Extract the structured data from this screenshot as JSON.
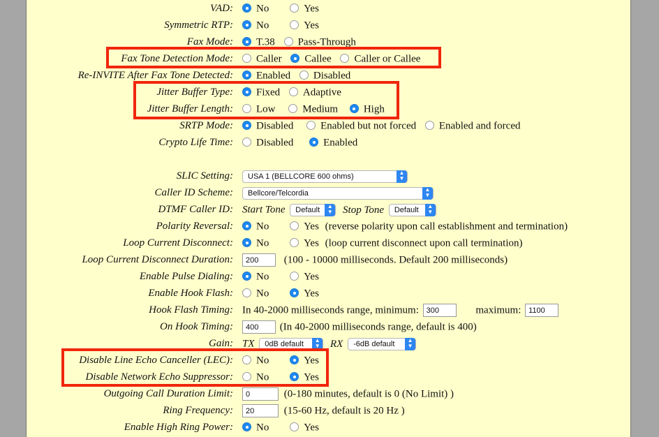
{
  "rows": {
    "vad": {
      "label": "VAD:",
      "opt1": "No",
      "opt2": "Yes"
    },
    "srtp_sym": {
      "label": "Symmetric RTP:",
      "opt1": "No",
      "opt2": "Yes"
    },
    "fax_mode": {
      "label": "Fax Mode:",
      "opt1": "T.38",
      "opt2": "Pass-Through"
    },
    "fax_tone": {
      "label": "Fax Tone Detection Mode:",
      "opt1": "Caller",
      "opt2": "Callee",
      "opt3": "Caller or Callee"
    },
    "reinvite": {
      "label": "Re-INVITE After Fax Tone Detected:",
      "opt1": "Enabled",
      "opt2": "Disabled"
    },
    "jb_type": {
      "label": "Jitter Buffer Type:",
      "opt1": "Fixed",
      "opt2": "Adaptive"
    },
    "jb_len": {
      "label": "Jitter Buffer Length:",
      "opt1": "Low",
      "opt2": "Medium",
      "opt3": "High"
    },
    "srtp_mode": {
      "label": "SRTP Mode:",
      "opt1": "Disabled",
      "opt2": "Enabled but not forced",
      "opt3": "Enabled and forced"
    },
    "crypto": {
      "label": "Crypto Life Time:",
      "opt1": "Disabled",
      "opt2": "Enabled"
    },
    "slic": {
      "label": "SLIC Setting:",
      "value": "USA 1 (BELLCORE 600 ohms)"
    },
    "callerid": {
      "label": "Caller ID Scheme:",
      "value": "Bellcore/Telcordia"
    },
    "dtmf": {
      "label": "DTMF Caller ID:",
      "start_label": "Start Tone",
      "start_value": "Default",
      "stop_label": "Stop Tone",
      "stop_value": "Default"
    },
    "polarity": {
      "label": "Polarity Reversal:",
      "opt1": "No",
      "opt2": "Yes",
      "note": "(reverse polarity upon call establishment and termination)"
    },
    "loop_disc": {
      "label": "Loop Current Disconnect:",
      "opt1": "No",
      "opt2": "Yes",
      "note": "(loop current disconnect upon call termination)"
    },
    "loop_dur": {
      "label": "Loop Current Disconnect Duration:",
      "value": "200",
      "note": "(100 - 10000 milliseconds. Default 200 milliseconds)"
    },
    "pulse": {
      "label": "Enable Pulse Dialing:",
      "opt1": "No",
      "opt2": "Yes"
    },
    "hookflash": {
      "label": "Enable Hook Flash:",
      "opt1": "No",
      "opt2": "Yes"
    },
    "hf_timing": {
      "label": "Hook Flash Timing:",
      "prefix": "In 40-2000 milliseconds range, minimum:",
      "min_value": "300",
      "max_label": "maximum:",
      "max_value": "1100"
    },
    "onhook": {
      "label": "On Hook Timing:",
      "value": "400",
      "note": "(In 40-2000 milliseconds range, default is 400)"
    },
    "gain": {
      "label": "Gain:",
      "tx_label": "TX",
      "tx_value": "0dB default",
      "rx_label": "RX",
      "rx_value": "-6dB default"
    },
    "lec": {
      "label": "Disable Line Echo Canceller (LEC):",
      "opt1": "No",
      "opt2": "Yes"
    },
    "nes": {
      "label": "Disable Network Echo Suppressor:",
      "opt1": "No",
      "opt2": "Yes"
    },
    "outlimit": {
      "label": "Outgoing Call Duration Limit:",
      "value": "0",
      "note": "(0-180 minutes, default is 0 (No Limit) )"
    },
    "ringfreq": {
      "label": "Ring Frequency:",
      "value": "20",
      "note": "(15-60 Hz, default is 20 Hz )"
    },
    "highring": {
      "label": "Enable High Ring Power:",
      "opt1": "No",
      "opt2": "Yes"
    }
  },
  "colors": {
    "background": "#ffffcc",
    "highlight": "#f0260c",
    "radio_selected": "#1e88f0"
  }
}
